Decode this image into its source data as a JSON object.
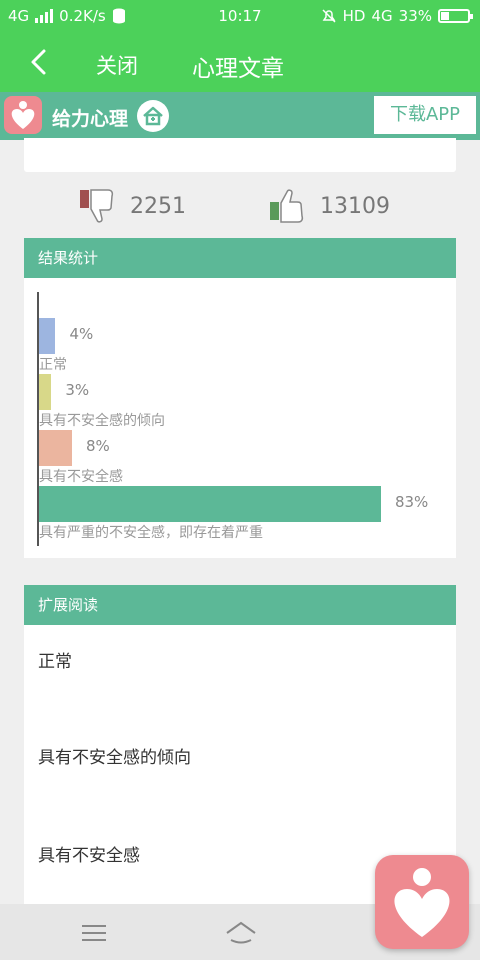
{
  "status_bar": {
    "network": "4G",
    "speed": "0.2K/s",
    "time": "10:17",
    "hd": "HD",
    "network_right": "4G",
    "battery": "33%"
  },
  "nav": {
    "close_label": "关闭",
    "title": "心理文章"
  },
  "banner": {
    "app_name": "给力心理",
    "download_label": "下载APP"
  },
  "votes": {
    "dislike_count": "2251",
    "like_count": "13109"
  },
  "stats": {
    "title": "结果统计"
  },
  "chart_data": {
    "type": "bar",
    "orientation": "horizontal",
    "categories": [
      "正常",
      "具有不安全感的倾向",
      "具有不安全感",
      "具有严重的不安全感，即存在着严重"
    ],
    "values": [
      4,
      3,
      8,
      83
    ],
    "labels": [
      "4%",
      "3%",
      "8%",
      "83%"
    ],
    "colors": [
      "#9db5e0",
      "#d8d889",
      "#ebb59f",
      "#5cb897"
    ],
    "xlim": [
      0,
      100
    ]
  },
  "reading": {
    "title": "扩展阅读",
    "items": [
      "正常",
      "具有不安全感的倾向",
      "具有不安全感"
    ]
  },
  "colors": {
    "primary_green": "#4cd15a",
    "teal": "#5cb897",
    "logo_pink": "#ee8a90"
  }
}
